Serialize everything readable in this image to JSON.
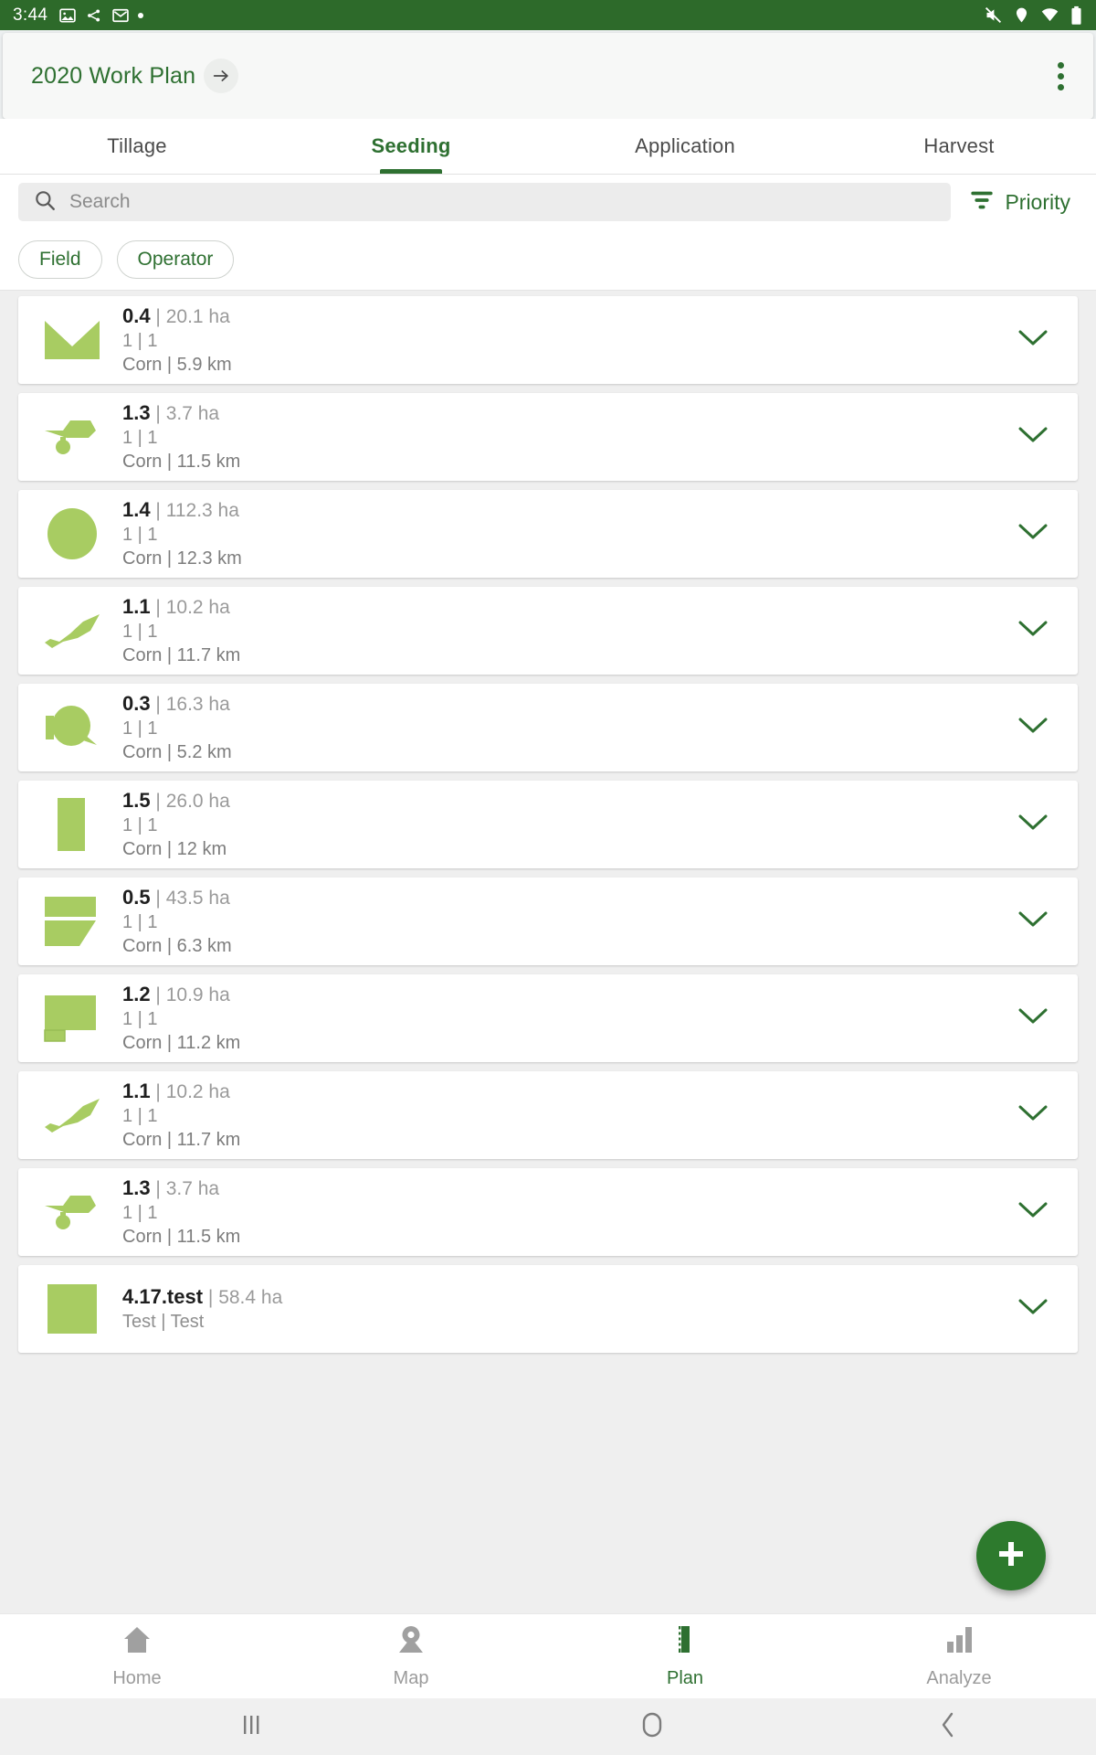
{
  "status_bar": {
    "time": "3:44",
    "left_icons": [
      "image-icon",
      "bluetooth-share-icon",
      "gmail-icon",
      "dot-indicator"
    ],
    "right_icons": [
      "mute-icon",
      "location-icon",
      "wifi-icon",
      "battery-icon"
    ],
    "background_color": "#2d6a2a"
  },
  "app_bar": {
    "title": "2020 Work Plan",
    "arrow_icon": "arrow-right-icon",
    "overflow_icon": "more-vertical-icon"
  },
  "tabs": [
    {
      "label": "Tillage",
      "active": false
    },
    {
      "label": "Seeding",
      "active": true
    },
    {
      "label": "Application",
      "active": false
    },
    {
      "label": "Harvest",
      "active": false
    }
  ],
  "search": {
    "placeholder": "Search",
    "icon": "search-icon"
  },
  "sort": {
    "label": "Priority",
    "icon": "filter-sort-icon"
  },
  "filter_chips": [
    {
      "label": "Field"
    },
    {
      "label": "Operator"
    }
  ],
  "list_rows": [
    {
      "name": "0.4",
      "area": "20.1 ha",
      "counts": "1 | 1",
      "crop_distance": "Corn | 5.9 km",
      "shape": "chevron",
      "expand_icon": "chevron-down-icon"
    },
    {
      "name": "1.3",
      "area": "3.7 ha",
      "counts": "1 | 1",
      "crop_distance": "Corn | 11.5 km",
      "shape": "hammer",
      "expand_icon": "chevron-down-icon"
    },
    {
      "name": "1.4",
      "area": "112.3 ha",
      "counts": "1 | 1",
      "crop_distance": "Corn | 12.3 km",
      "shape": "circle",
      "expand_icon": "chevron-down-icon"
    },
    {
      "name": "1.1",
      "area": "10.2 ha",
      "counts": "1 | 1",
      "crop_distance": "Corn | 11.7 km",
      "shape": "wedge",
      "expand_icon": "chevron-down-icon"
    },
    {
      "name": "0.3",
      "area": "16.3 ha",
      "counts": "1 | 1",
      "crop_distance": "Corn | 5.2 km",
      "shape": "balloon",
      "expand_icon": "chevron-down-icon"
    },
    {
      "name": "1.5",
      "area": "26.0 ha",
      "counts": "1 | 1",
      "crop_distance": "Corn | 12 km",
      "shape": "rect",
      "expand_icon": "chevron-down-icon"
    },
    {
      "name": "0.5",
      "area": "43.5 ha",
      "counts": "1 | 1",
      "crop_distance": "Corn | 6.3 km",
      "shape": "split",
      "expand_icon": "chevron-down-icon"
    },
    {
      "name": "1.2",
      "area": "10.9 ha",
      "counts": "1 | 1",
      "crop_distance": "Corn | 11.2 km",
      "shape": "lshape",
      "expand_icon": "chevron-down-icon"
    },
    {
      "name": "1.1",
      "area": "10.2 ha",
      "counts": "1 | 1",
      "crop_distance": "Corn | 11.7 km",
      "shape": "wedge",
      "expand_icon": "chevron-down-icon"
    },
    {
      "name": "1.3",
      "area": "3.7 ha",
      "counts": "1 | 1",
      "crop_distance": "Corn | 11.5 km",
      "shape": "hammer",
      "expand_icon": "chevron-down-icon"
    },
    {
      "name": "4.17.test",
      "area": "58.4 ha",
      "counts": "Test | Test",
      "crop_distance": "",
      "shape": "square",
      "expand_icon": "chevron-down-icon"
    }
  ],
  "fab": {
    "icon": "plus-icon",
    "color": "#2d7a2d"
  },
  "bottom_nav": [
    {
      "label": "Home",
      "icon": "home-icon",
      "active": false
    },
    {
      "label": "Map",
      "icon": "map-pin-icon",
      "active": false
    },
    {
      "label": "Plan",
      "icon": "plan-icon",
      "active": true
    },
    {
      "label": "Analyze",
      "icon": "bar-chart-icon",
      "active": false
    }
  ],
  "system_nav": [
    {
      "icon": "recents-icon"
    },
    {
      "icon": "home-circle-icon"
    },
    {
      "icon": "back-icon"
    }
  ],
  "colors": {
    "primary_green": "#2e7031",
    "status_bar_green": "#2d6a2a",
    "field_green": "#a8cc62",
    "fab_green": "#2d7a2d"
  }
}
